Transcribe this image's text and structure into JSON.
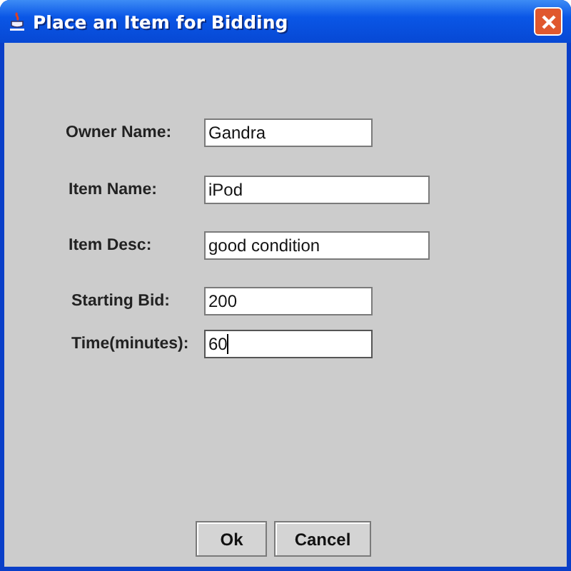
{
  "window": {
    "title": "Place an Item for Bidding"
  },
  "fields": [
    {
      "label": "Owner Name:",
      "value": "Gandra",
      "focused": false
    },
    {
      "label": "Item Name:",
      "value": "iPod",
      "focused": false
    },
    {
      "label": "Item Desc:",
      "value": "good condition",
      "focused": false
    },
    {
      "label": "Starting Bid:",
      "value": "200",
      "focused": false
    },
    {
      "label": "Time(minutes):",
      "value": "60",
      "focused": true
    }
  ],
  "buttons": [
    "Ok",
    "Cancel"
  ]
}
